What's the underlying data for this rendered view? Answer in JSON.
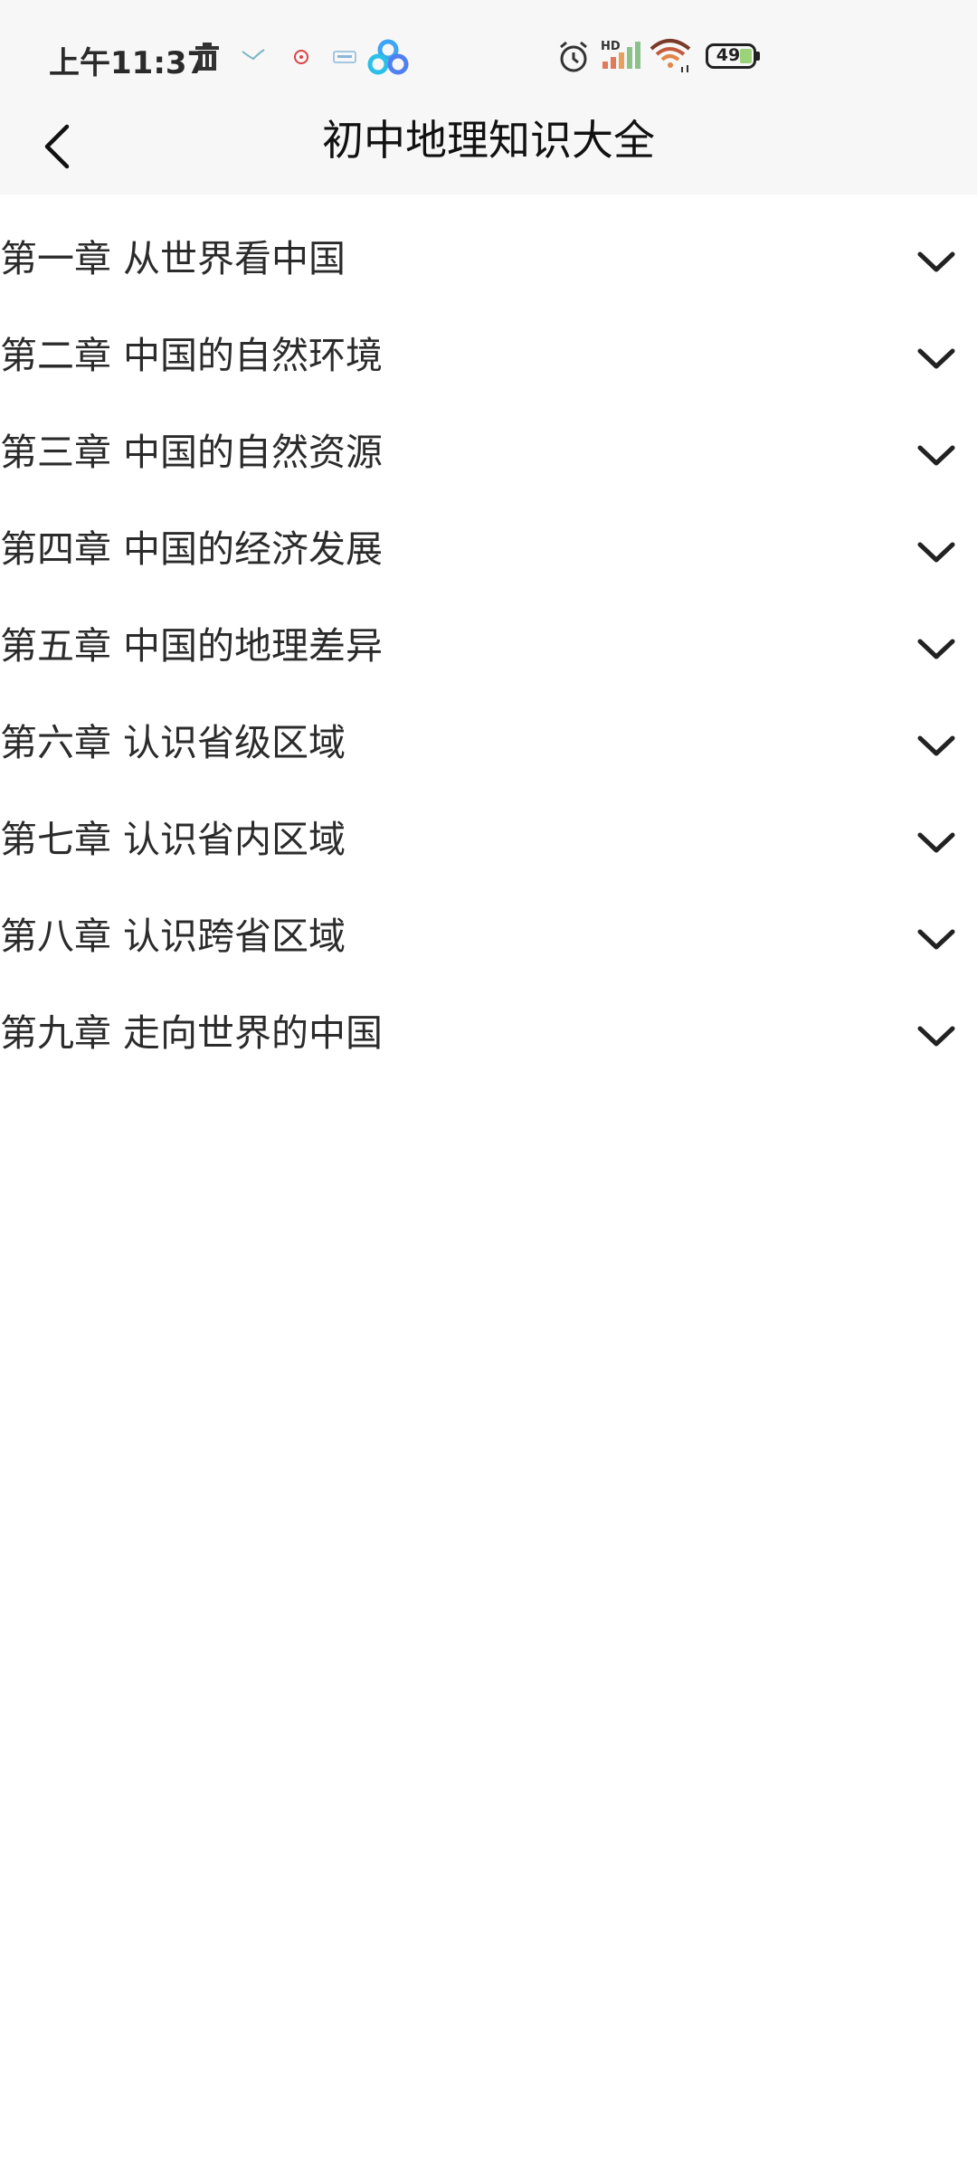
{
  "status_bar": {
    "time": "上午11:37",
    "signal_label": "HD",
    "battery_level": "49",
    "icons": [
      "trash-icon",
      "bird-icon",
      "app-icon",
      "keyboard-icon",
      "cloud-app-icon",
      "alarm-icon",
      "signal-icon",
      "wifi-icon",
      "battery-icon"
    ]
  },
  "header": {
    "title": "初中地理知识大全",
    "background": "#f7f7f7"
  },
  "chapters": [
    "第一章 从世界看中国",
    "第二章 中国的自然环境",
    "第三章 中国的自然资源",
    "第四章 中国的经济发展",
    "第五章 中国的地理差异",
    "第六章 认识省级区域",
    "第七章 认识省内区域",
    "第八章 认识跨省区域",
    "第九章 走向世界的中国"
  ]
}
